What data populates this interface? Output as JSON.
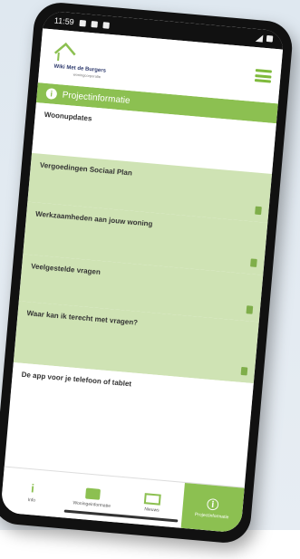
{
  "statusbar": {
    "time": "11:59"
  },
  "header": {
    "logo_name": "Wiki Met de Burgers",
    "logo_sub": "woningcorporatie"
  },
  "section": {
    "title": "Projectinformatie"
  },
  "items": [
    {
      "label": "Woonupdates",
      "has_doc": false
    },
    {
      "label": "Vergoedingen Sociaal Plan",
      "has_doc": true
    },
    {
      "label": "Werkzaamheden aan jouw woning",
      "has_doc": true
    },
    {
      "label": "Veelgestelde vragen",
      "has_doc": true
    },
    {
      "label": "Waar kan ik terecht met vragen?",
      "has_doc": true
    },
    {
      "label": "De app voor je telefoon of tablet",
      "has_doc": false
    }
  ],
  "nav": [
    {
      "label": "Info",
      "icon": "info-icon",
      "active": false
    },
    {
      "label": "Woningeinformatie",
      "icon": "house-icon",
      "active": false
    },
    {
      "label": "Nieuws",
      "icon": "news-icon",
      "active": false
    },
    {
      "label": "Projectinformatie",
      "icon": "info-circle-icon",
      "active": true
    }
  ],
  "colors": {
    "brand_green": "#8cc051",
    "light_green": "#cfe3b4",
    "navy": "#2f3b6e"
  }
}
